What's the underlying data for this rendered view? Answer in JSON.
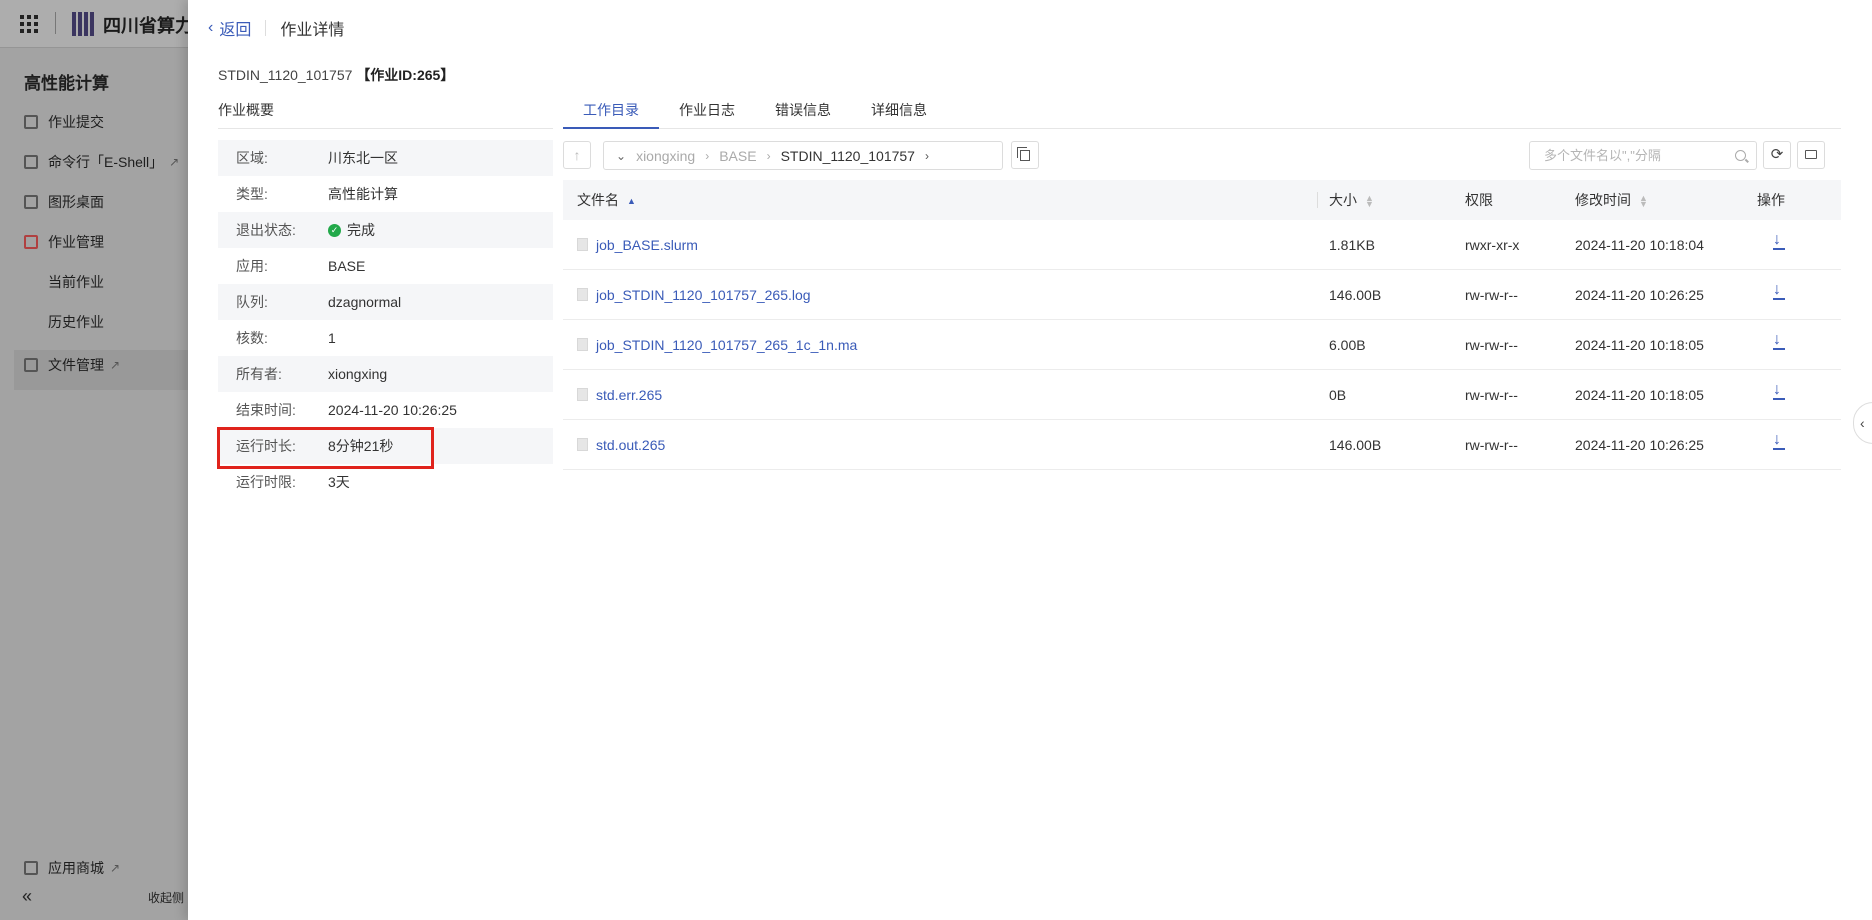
{
  "background": {
    "logo_text": "四川省算力",
    "sidebar": {
      "title": "高性能计算",
      "items": [
        {
          "label": "作业提交",
          "icon": "edit-icon"
        },
        {
          "label": "命令行「E-Shell」",
          "icon": "terminal-icon"
        },
        {
          "label": "图形桌面",
          "icon": "desktop-icon"
        },
        {
          "label": "作业管理",
          "icon": "job-icon"
        },
        {
          "label": "文件管理",
          "icon": "folder-icon"
        }
      ],
      "sub_items": [
        "当前作业",
        "历史作业"
      ],
      "footer_item": "应用商城",
      "collapse_label": "收起侧"
    }
  },
  "header": {
    "back_label": "返回",
    "title": "作业详情"
  },
  "job": {
    "name": "STDIN_1120_101757",
    "id_label": "【作业ID:265】"
  },
  "summary": {
    "label": "作业概要",
    "rows": [
      {
        "key": "区域:",
        "value": "川东北一区"
      },
      {
        "key": "类型:",
        "value": "高性能计算"
      },
      {
        "key": "退出状态:",
        "value": "完成"
      },
      {
        "key": "应用:",
        "value": "BASE"
      },
      {
        "key": "队列:",
        "value": "dzagnormal"
      },
      {
        "key": "核数:",
        "value": "1"
      },
      {
        "key": "所有者:",
        "value": "xiongxing"
      },
      {
        "key": "结束时间:",
        "value": "2024-11-20 10:26:25"
      },
      {
        "key": "运行时长:",
        "value": "8分钟21秒"
      },
      {
        "key": "运行时限:",
        "value": "3天"
      }
    ]
  },
  "tabs": [
    "工作目录",
    "作业日志",
    "错误信息",
    "详细信息"
  ],
  "path": [
    "xiongxing",
    "BASE",
    "STDIN_1120_101757"
  ],
  "search": {
    "placeholder": "多个文件名以\",\"分隔"
  },
  "table": {
    "headers": {
      "name": "文件名",
      "size": "大小",
      "perm": "权限",
      "time": "修改时间",
      "op": "操作"
    },
    "rows": [
      {
        "name": "job_BASE.slurm",
        "size": "1.81KB",
        "perm": "rwxr-xr-x",
        "time": "2024-11-20 10:18:04"
      },
      {
        "name": "job_STDIN_1120_101757_265.log",
        "size": "146.00B",
        "perm": "rw-rw-r--",
        "time": "2024-11-20 10:26:25"
      },
      {
        "name": "job_STDIN_1120_101757_265_1c_1n.ma",
        "size": "6.00B",
        "perm": "rw-rw-r--",
        "time": "2024-11-20 10:18:05"
      },
      {
        "name": "std.err.265",
        "size": "0B",
        "perm": "rw-rw-r--",
        "time": "2024-11-20 10:18:05"
      },
      {
        "name": "std.out.265",
        "size": "146.00B",
        "perm": "rw-rw-r--",
        "time": "2024-11-20 10:26:25"
      }
    ]
  }
}
